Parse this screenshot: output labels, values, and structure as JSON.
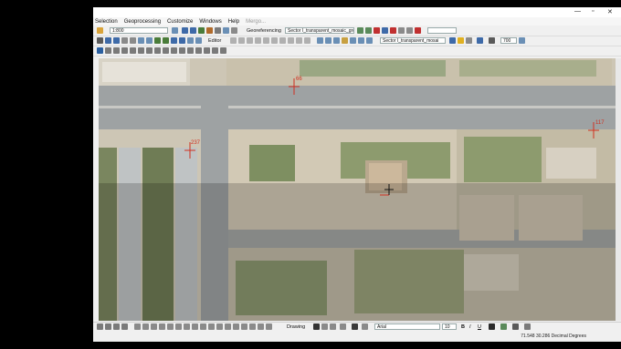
{
  "menu": {
    "items": [
      "Selection",
      "Geoprocessing",
      "Customize",
      "Windows",
      "Help"
    ],
    "disabled_item": "Mergo..."
  },
  "toolbar": {
    "scale": "1:800",
    "georeferencing_label": "Georeferencing",
    "georef_layer": "Sector I_transparent_mosaic_gro",
    "editor_label": "Editor",
    "layer_dropdown": "Sector I_transparent_mosai",
    "transparency": "700"
  },
  "map": {
    "labels": [
      "66",
      "117",
      "237"
    ],
    "accent_marker_color": "#d03020"
  },
  "drawing": {
    "label": "Drawing",
    "font_name": "Arial",
    "font_size": "10",
    "bold": "B",
    "italic": "I",
    "underline": "U"
  },
  "status": {
    "coordinates": "71.548  30.286 Decimal Degrees"
  },
  "colors": {
    "bg": "#000000",
    "window": "#f0f0f0",
    "road": "#9fa3a4",
    "sand": "#cfc6b4",
    "veg": "#7f8f62"
  }
}
